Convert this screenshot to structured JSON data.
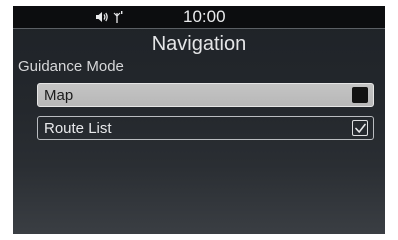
{
  "status": {
    "clock": "10:00",
    "icons": [
      "speaker-volume-icon",
      "antenna-signal-icon"
    ]
  },
  "header": {
    "title": "Navigation"
  },
  "section": {
    "label": "Guidance Mode"
  },
  "options": [
    {
      "label": "Map",
      "checked": false,
      "highlighted": true
    },
    {
      "label": "Route List",
      "checked": true,
      "highlighted": false
    }
  ],
  "colors": {
    "status_bar_bg": "#0c0d0f",
    "highlight_row": "#c0c0c0",
    "screen_bg_top": "#1e2227",
    "text_light": "#e4e5e7"
  }
}
